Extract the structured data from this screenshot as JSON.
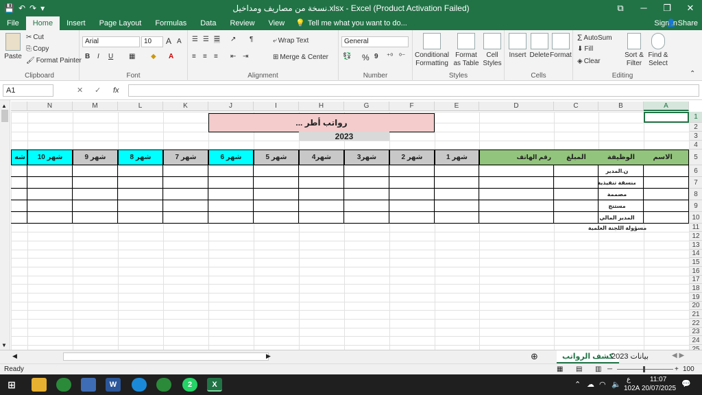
{
  "window": {
    "title": "نسخة من مصاريف ومداخيل.xlsx - Excel (Product Activation Failed)"
  },
  "qat": {
    "save": "💾",
    "undo": "↶",
    "redo": "↷",
    "customize": "▾"
  },
  "tabs": [
    "File",
    "Home",
    "Insert",
    "Page Layout",
    "Formulas",
    "Data",
    "Review",
    "View"
  ],
  "tellme": "Tell me what you want to do...",
  "signin": "Sign in",
  "share": "Share",
  "ribbon": {
    "clipboard": {
      "paste": "Paste",
      "cut": "Cut",
      "copy": "Copy",
      "format_painter": "Format Painter",
      "label": "Clipboard"
    },
    "font": {
      "name": "Arial",
      "size": "10",
      "grow": "A",
      "shrink": "A",
      "bold": "B",
      "italic": "I",
      "underline": "U",
      "label": "Font"
    },
    "alignment": {
      "wrap": "Wrap Text",
      "merge": "Merge & Center",
      "label": "Alignment"
    },
    "number": {
      "format": "General",
      "percent": "%",
      "comma": "9",
      "label": "Number"
    },
    "styles": {
      "conditional": "Conditional Formatting",
      "format_table": "Format as Table",
      "cell_styles": "Cell Styles",
      "label": "Styles"
    },
    "cells": {
      "insert": "Insert",
      "delete": "Delete",
      "format": "Format",
      "label": "Cells"
    },
    "editing": {
      "autosum": "AutoSum",
      "fill": "Fill",
      "clear": "Clear",
      "sort": "Sort & Filter",
      "find": "Find & Select",
      "label": "Editing"
    }
  },
  "formula": {
    "namebox": "A1",
    "fx": "fx",
    "cancel": "✕",
    "enter": "✓"
  },
  "columns": [
    "N",
    "M",
    "L",
    "K",
    "J",
    "I",
    "H",
    "G",
    "F",
    "E",
    "D",
    "C",
    "B",
    "A"
  ],
  "rows": [
    "1",
    "2",
    "3",
    "4",
    "5",
    "6",
    "7",
    "8",
    "9",
    "10",
    "11",
    "12",
    "13",
    "14",
    "15",
    "16",
    "17",
    "18",
    "19",
    "20",
    "21",
    "22",
    "23",
    "24",
    "25"
  ],
  "sheet": {
    "title": "رواتب أطر ...",
    "year": "2023",
    "headers": {
      "name": "الاسم",
      "job": "الوظيفة",
      "amount": "المبلغ",
      "phone": "رقم الهاتف",
      "months": [
        "شهر 1",
        "شهر 2",
        "شهر3",
        "شهر4",
        "شهر 5",
        "شهر 6",
        "شهر 7",
        "شهر 8",
        "شهر 9",
        "شهر 10",
        "شه"
      ]
    },
    "jobs": [
      "ن.المدير",
      "منسقة تنفيذية",
      "مصممة",
      "مستنج",
      "المدير المالي",
      "مسؤولة اللجنة العلمية"
    ]
  },
  "sheettabs": [
    "بيانات 2023",
    "كشف الرواتب"
  ],
  "status": {
    "ready": "Ready",
    "zoom": "100 %"
  },
  "taskbar": {
    "lang": "ع",
    "locale": "102A",
    "time": "11:07",
    "date": "20/07/2025",
    "badge": "2"
  }
}
